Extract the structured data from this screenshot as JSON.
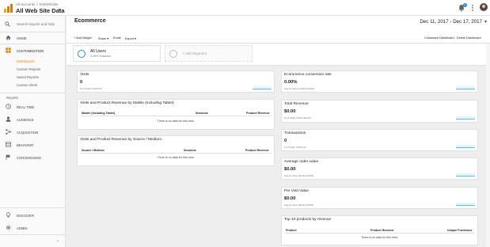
{
  "header": {
    "breadcrumb": "All accounts > TestWebsite",
    "view_name": "All Web Site Data",
    "notification_count": "1"
  },
  "sidebar": {
    "search_placeholder": "Search reports and help",
    "home": "HOME",
    "customization": "CUSTOMIZATION",
    "sub_items": [
      "Dashboards",
      "Custom Reports",
      "Saved Reports",
      "Custom Alerts"
    ],
    "reports_section": "Reports",
    "reports": [
      "REAL-TIME",
      "AUDIENCE",
      "ACQUISITION",
      "BEHAVIOR",
      "CONVERSIONS"
    ],
    "discover": "DISCOVER",
    "admin": "ADMIN",
    "collapse": "‹"
  },
  "dashboard": {
    "title": "Ecommerce",
    "date_range": "Dec 11, 2017 - Dec 17, 2017",
    "toolbar": {
      "add_widget": "+ Add Widget",
      "share": "Share ▾",
      "email": "Email",
      "export": "Export ▾",
      "customize": "Customize Dashboard",
      "delete": "Delete Dashboard"
    }
  },
  "segments": {
    "active": {
      "name": "All Users",
      "sub": "0.00% Sessions"
    },
    "add_label": "+ Add Segment"
  },
  "widgets_left": {
    "visits": {
      "title": "Visits",
      "value": "0",
      "sub": "% of Total: 0.00% (0)"
    },
    "mobile_table": {
      "title": "Visits and Product Revenue by Mobile (Including Tablet)",
      "columns": [
        "Mobile (Including Tablet)",
        "Sessions",
        "Product Revenue"
      ],
      "empty": "There is no data for this view."
    },
    "source_table": {
      "title": "Visits and Product Revenue by Source / Medium",
      "columns": [
        "Source / Medium",
        "Sessions",
        "Product Revenue"
      ],
      "empty": "There is no data for this view."
    }
  },
  "widgets_right": {
    "conversion": {
      "title": "Ecommerce conversion rate",
      "value": "0.00%",
      "sub": "Avg for View: 0.00% (0.00%)"
    },
    "revenue": {
      "title": "Total Revenue",
      "value": "$0.00",
      "sub": "% of Total: 0.00% ($0.00)"
    },
    "transactions": {
      "title": "Transactions",
      "value": "0",
      "sub": "% of Total: 0.00% (0)"
    },
    "aov": {
      "title": "Average order value",
      "value": "$0.00",
      "sub": "Avg for View: $0.00 (0.00%)"
    },
    "per_visit": {
      "title": "Per Visit Value",
      "value": "$0.00",
      "sub": "Avg for View: $0.00 (0.00%)"
    },
    "top_products": {
      "title": "Top 10 products by revenue",
      "columns": [
        "Product",
        "Product Revenue",
        "Unique Purchases"
      ],
      "empty": "There is no data for this view."
    }
  },
  "colors": {
    "accent_orange": "#f57c00",
    "accent_blue": "#1e88e5",
    "sparkline": "#4fc3f7"
  }
}
